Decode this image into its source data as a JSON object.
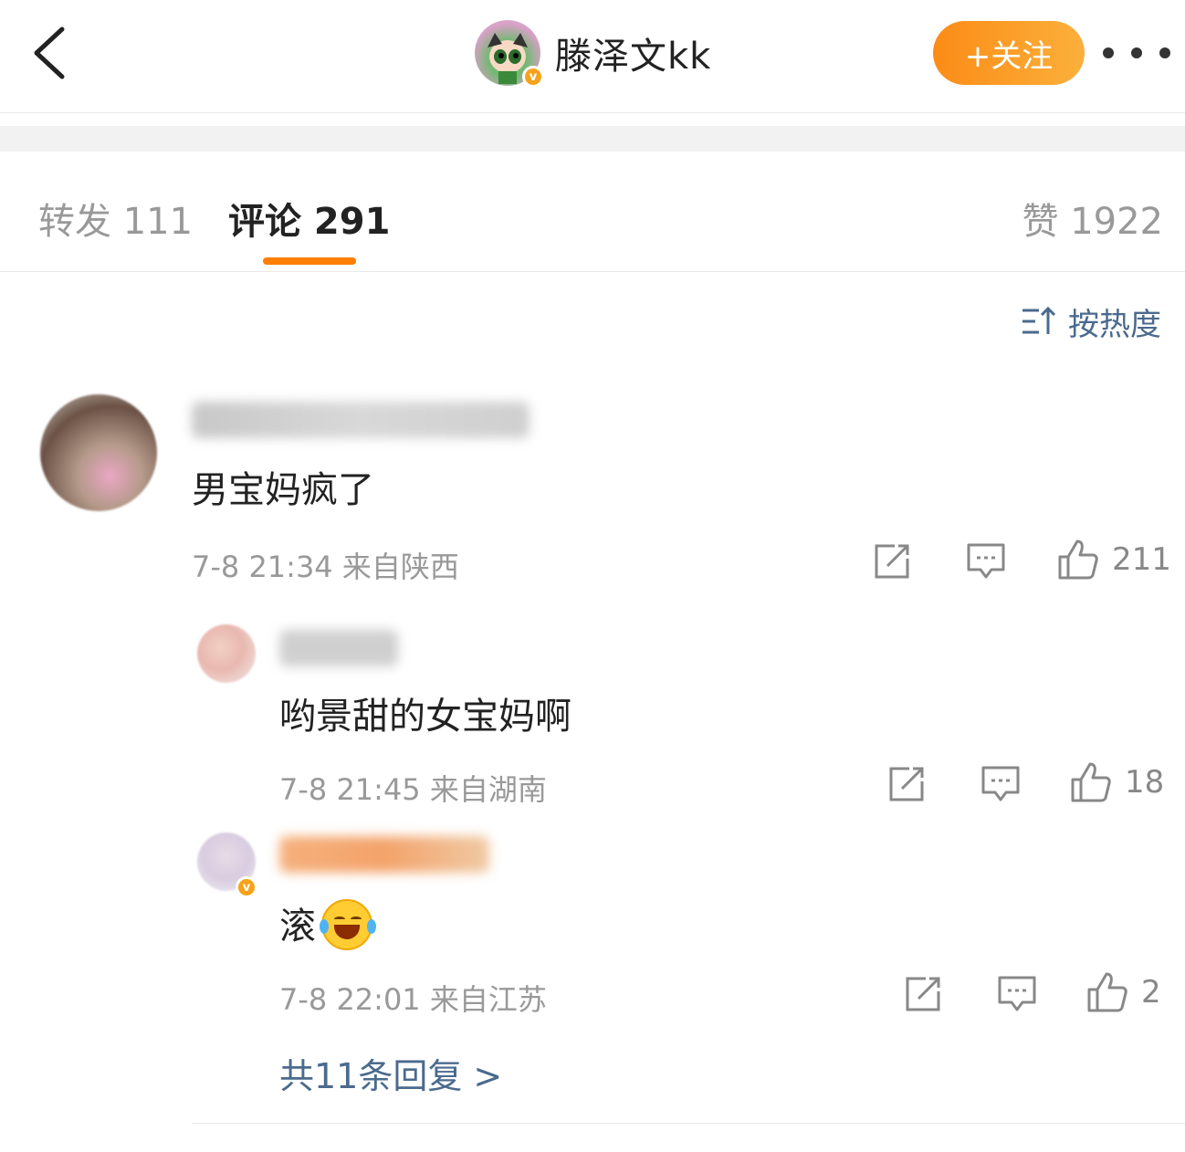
{
  "header": {
    "username": "滕泽文kk",
    "verified_badge": "v",
    "follow_label": "+关注",
    "back_icon": "chevron-left-icon",
    "more_icon": "more-dots-icon"
  },
  "tabs": {
    "repost": "转发 111",
    "comment": "评论 291",
    "like": "赞 1922"
  },
  "sort": {
    "label": "按热度",
    "icon": "sort-icon"
  },
  "comments": [
    {
      "text": "男宝妈疯了",
      "meta": "7-8 21:34  来自陕西",
      "likes": "211"
    }
  ],
  "replies": [
    {
      "text": "哟景甜的女宝妈啊",
      "meta": "7-8 21:45  来自湖南",
      "likes": "18"
    },
    {
      "text": "滚",
      "meta": "7-8 22:01  来自江苏",
      "likes": "2"
    }
  ],
  "more_replies": "共11条回复 >",
  "colors": {
    "accent": "#ff7e00",
    "link": "#4b6a8e",
    "muted": "#999999"
  }
}
